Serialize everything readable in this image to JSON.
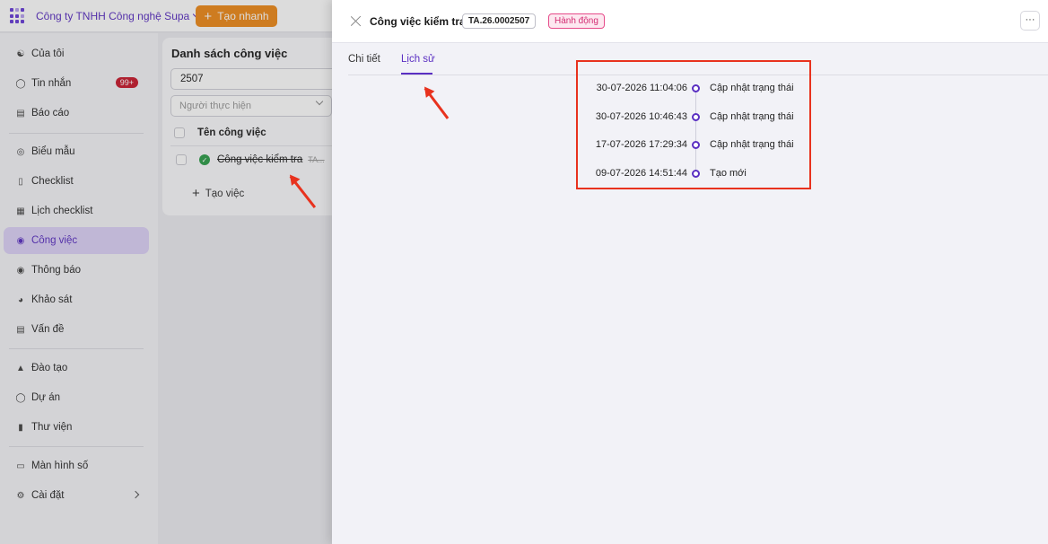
{
  "topbar": {
    "company": "Công ty TNHH Công nghệ Supa",
    "quick_create": "Tạo nhanh",
    "plus": "+"
  },
  "sidebar": {
    "items": [
      {
        "label": "Của tôi",
        "icon": "user-icon"
      },
      {
        "label": "Tin nhắn",
        "icon": "chat-icon",
        "badge": "99+"
      },
      {
        "label": "Báo cáo",
        "icon": "report-icon"
      },
      {
        "label": "Biểu mẫu",
        "icon": "form-icon"
      },
      {
        "label": "Checklist",
        "icon": "checklist-icon"
      },
      {
        "label": "Lịch checklist",
        "icon": "calendar-icon"
      },
      {
        "label": "Công việc",
        "icon": "task-icon",
        "active": true
      },
      {
        "label": "Thông báo",
        "icon": "bell-icon"
      },
      {
        "label": "Khảo sát",
        "icon": "survey-icon"
      },
      {
        "label": "Vấn đề",
        "icon": "issue-icon"
      },
      {
        "label": "Đào tạo",
        "icon": "training-icon"
      },
      {
        "label": "Dự án",
        "icon": "project-icon"
      },
      {
        "label": "Thư viện",
        "icon": "library-icon"
      },
      {
        "label": "Màn hình số",
        "icon": "monitor-icon"
      },
      {
        "label": "Cài đặt",
        "icon": "settings-icon"
      }
    ]
  },
  "task_list": {
    "title": "Danh sách công việc",
    "search_value": "2507",
    "assignee_placeholder": "Người thực hiện",
    "column_header": "Tên công việc",
    "row_name": "Công việc kiểm tra",
    "row_code": "TA...",
    "add_task": "Tạo việc"
  },
  "drawer": {
    "title": "Công việc kiểm tra",
    "code": "TA.26.0002507",
    "action": "Hành động",
    "more": "···",
    "tabs": [
      "Chi tiết",
      "Lịch sử"
    ],
    "active_tab": "Lịch sử",
    "history": [
      {
        "time": "30-07-2026 11:04:06",
        "label": "Cập nhật trạng thái"
      },
      {
        "time": "30-07-2026 10:46:43",
        "label": "Cập nhật trạng thái"
      },
      {
        "time": "17-07-2026 17:29:34",
        "label": "Cập nhật trạng thái"
      },
      {
        "time": "09-07-2026 14:51:44",
        "label": "Tạo mới"
      }
    ]
  },
  "colors": {
    "accent": "#5a2fc2",
    "orange": "#ee8a1a",
    "annotation_red": "#e8321e",
    "success": "#2e9e4a"
  }
}
